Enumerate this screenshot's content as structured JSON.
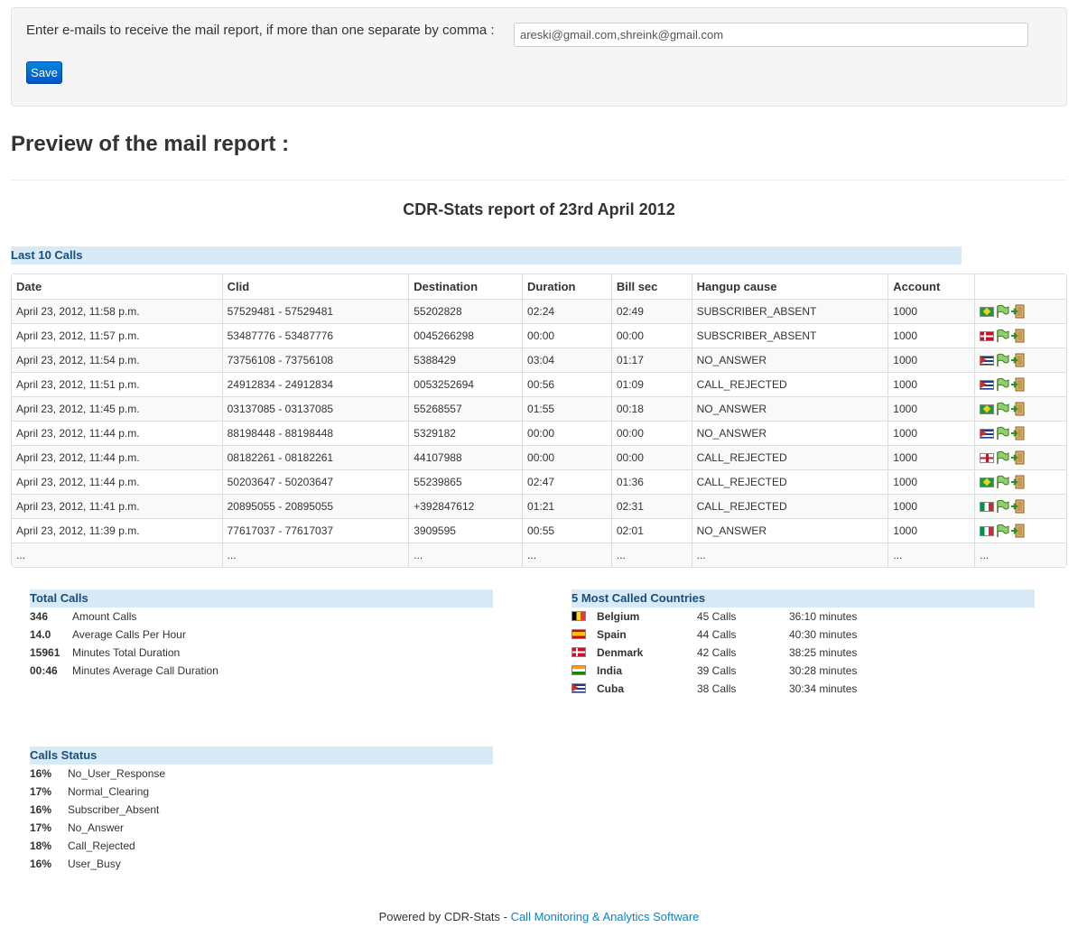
{
  "settings": {
    "email_label": "Enter e-mails to receive the mail report, if more than one separate by comma :",
    "email_value": "areski@gmail.com,shreink@gmail.com",
    "save_label": "Save"
  },
  "preview_title": "Preview of the mail report :",
  "report_title": "CDR-Stats report of 23rd April 2012",
  "last_calls": {
    "heading": "Last 10 Calls",
    "columns": [
      "Date",
      "Clid",
      "Destination",
      "Duration",
      "Bill sec",
      "Hangup cause",
      "Account",
      ""
    ],
    "rows": [
      {
        "date": "April 23, 2012, 11:58 p.m.",
        "clid": "57529481 - 57529481",
        "destination": "55202828",
        "duration": "02:24",
        "billsec": "02:49",
        "hangup": "SUBSCRIBER_ABSENT",
        "account": "1000",
        "flag": "br"
      },
      {
        "date": "April 23, 2012, 11:57 p.m.",
        "clid": "53487776 - 53487776",
        "destination": "0045266298",
        "duration": "00:00",
        "billsec": "00:00",
        "hangup": "SUBSCRIBER_ABSENT",
        "account": "1000",
        "flag": "dk"
      },
      {
        "date": "April 23, 2012, 11:54 p.m.",
        "clid": "73756108 - 73756108",
        "destination": "5388429",
        "duration": "03:04",
        "billsec": "01:17",
        "hangup": "NO_ANSWER",
        "account": "1000",
        "flag": "cu"
      },
      {
        "date": "April 23, 2012, 11:51 p.m.",
        "clid": "24912834 - 24912834",
        "destination": "0053252694",
        "duration": "00:56",
        "billsec": "01:09",
        "hangup": "CALL_REJECTED",
        "account": "1000",
        "flag": "cu"
      },
      {
        "date": "April 23, 2012, 11:45 p.m.",
        "clid": "03137085 - 03137085",
        "destination": "55268557",
        "duration": "01:55",
        "billsec": "00:18",
        "hangup": "NO_ANSWER",
        "account": "1000",
        "flag": "br"
      },
      {
        "date": "April 23, 2012, 11:44 p.m.",
        "clid": "88198448 - 88198448",
        "destination": "5329182",
        "duration": "00:00",
        "billsec": "00:00",
        "hangup": "NO_ANSWER",
        "account": "1000",
        "flag": "cu"
      },
      {
        "date": "April 23, 2012, 11:44 p.m.",
        "clid": "08182261 - 08182261",
        "destination": "44107988",
        "duration": "00:00",
        "billsec": "00:00",
        "hangup": "CALL_REJECTED",
        "account": "1000",
        "flag": "gb"
      },
      {
        "date": "April 23, 2012, 11:44 p.m.",
        "clid": "50203647 - 50203647",
        "destination": "55239865",
        "duration": "02:47",
        "billsec": "01:36",
        "hangup": "CALL_REJECTED",
        "account": "1000",
        "flag": "br"
      },
      {
        "date": "April 23, 2012, 11:41 p.m.",
        "clid": "20895055 - 20895055",
        "destination": "+392847612",
        "duration": "01:21",
        "billsec": "02:31",
        "hangup": "CALL_REJECTED",
        "account": "1000",
        "flag": "it"
      },
      {
        "date": "April 23, 2012, 11:39 p.m.",
        "clid": "77617037 - 77617037",
        "destination": "3909595",
        "duration": "00:55",
        "billsec": "02:01",
        "hangup": "NO_ANSWER",
        "account": "1000",
        "flag": "it"
      }
    ],
    "ellipsis": "..."
  },
  "total_calls": {
    "heading": "Total Calls",
    "items": [
      {
        "value": "346",
        "label": "Amount Calls"
      },
      {
        "value": "14.0",
        "label": "Average Calls Per Hour"
      },
      {
        "value": "15961",
        "label": "Minutes Total Duration"
      },
      {
        "value": "00:46",
        "label": "Minutes Average Call Duration"
      }
    ]
  },
  "countries": {
    "heading": "5 Most Called Countries",
    "items": [
      {
        "flag": "be",
        "name": "Belgium",
        "calls": "45 Calls",
        "minutes": "36:10 minutes"
      },
      {
        "flag": "es",
        "name": "Spain",
        "calls": "44 Calls",
        "minutes": "40:30 minutes"
      },
      {
        "flag": "dk",
        "name": "Denmark",
        "calls": "42 Calls",
        "minutes": "38:25 minutes"
      },
      {
        "flag": "in",
        "name": "India",
        "calls": "39 Calls",
        "minutes": "30:28 minutes"
      },
      {
        "flag": "cu",
        "name": "Cuba",
        "calls": "38 Calls",
        "minutes": "30:34 minutes"
      }
    ]
  },
  "calls_status": {
    "heading": "Calls Status",
    "items": [
      {
        "value": "16%",
        "label": "No_User_Response"
      },
      {
        "value": "17%",
        "label": "Normal_Clearing"
      },
      {
        "value": "16%",
        "label": "Subscriber_Absent"
      },
      {
        "value": "17%",
        "label": "No_Answer"
      },
      {
        "value": "18%",
        "label": "Call_Rejected"
      },
      {
        "value": "16%",
        "label": "User_Busy"
      }
    ]
  },
  "footer": {
    "prefix": "Powered by CDR-Stats - ",
    "link": "Call Monitoring & Analytics Software"
  }
}
